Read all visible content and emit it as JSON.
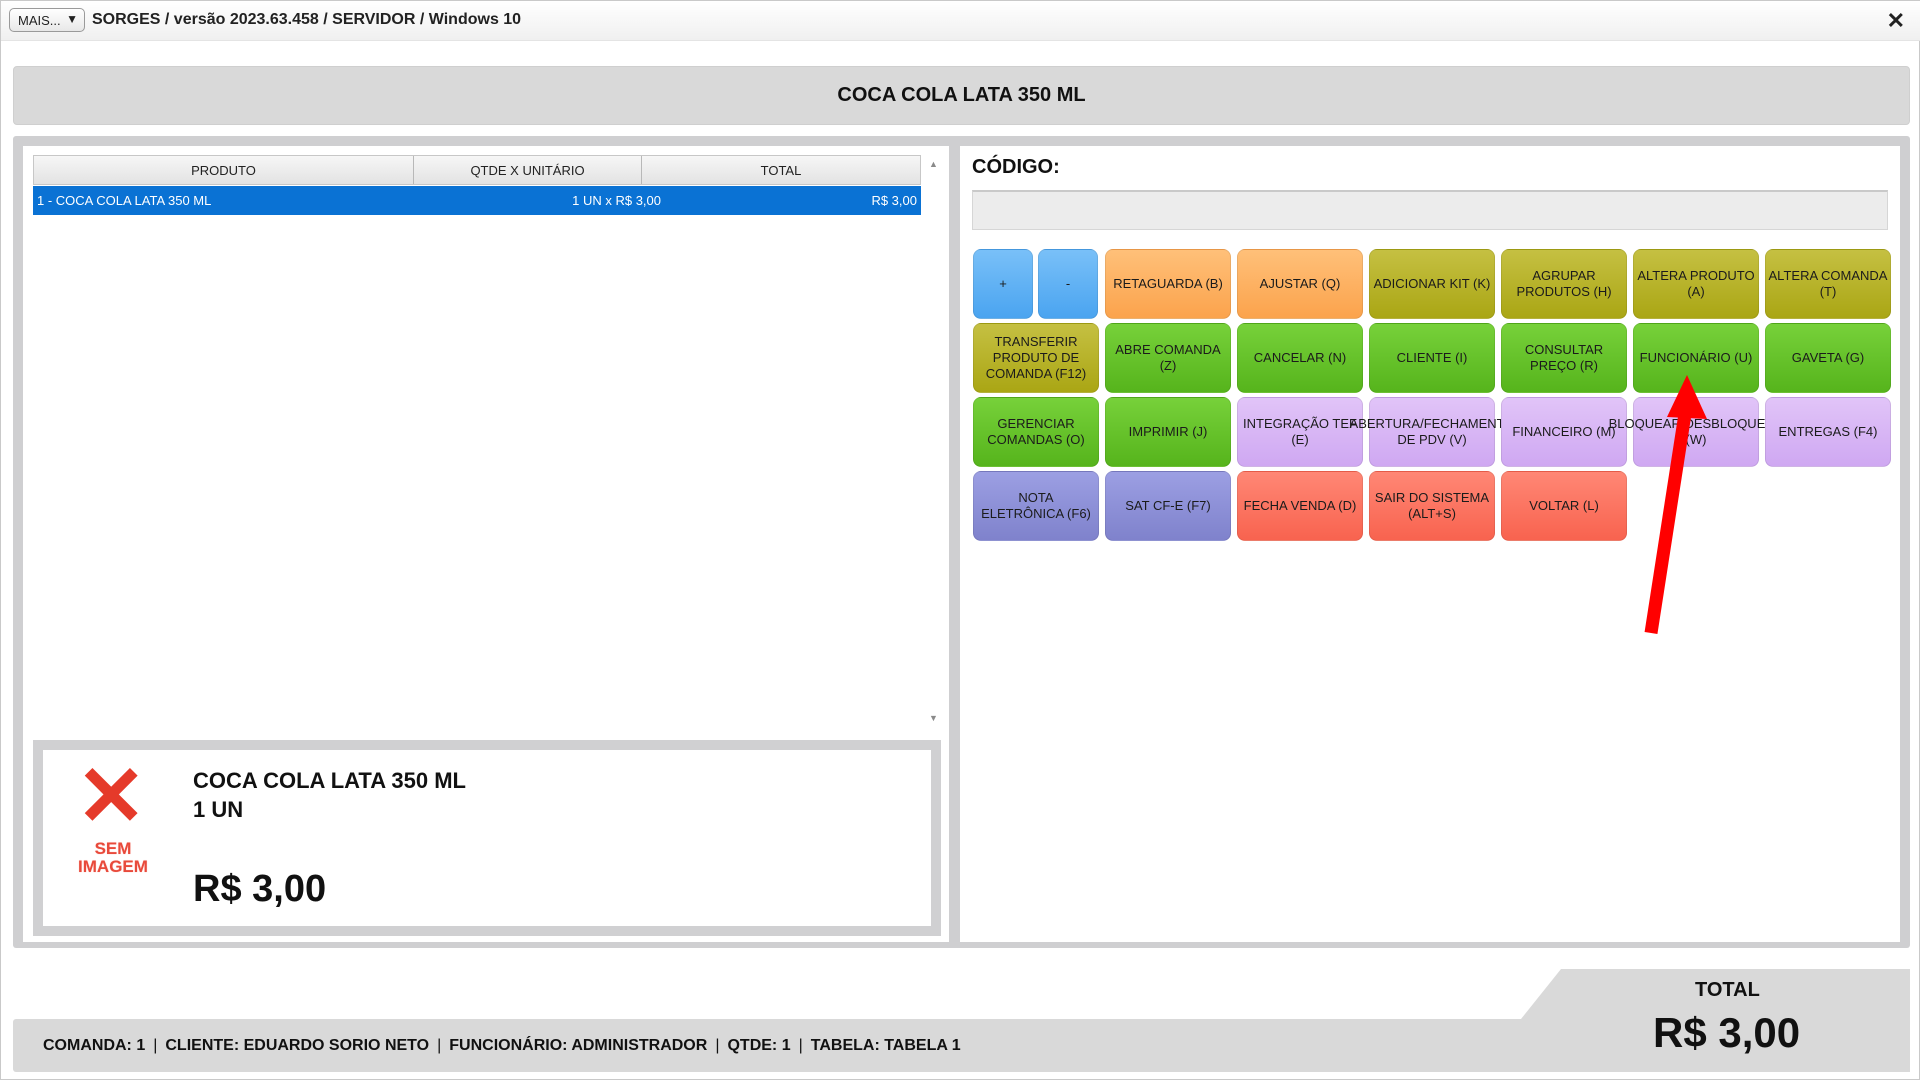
{
  "window": {
    "mais_label": "MAIS...",
    "mais_arrow": "▼",
    "title": "SORGES / versão 2023.63.458 / SERVIDOR / Windows 10",
    "close_glyph": "✕"
  },
  "product_header": "COCA COLA LATA 350 ML",
  "grid": {
    "columns": [
      "PRODUTO",
      "QTDE X UNITÁRIO",
      "TOTAL"
    ],
    "rows": [
      {
        "produto": "1 - COCA COLA LATA 350 ML",
        "qtde": "1 UN x R$ 3,00",
        "total": "R$ 3,00"
      }
    ],
    "scroll_up": "▲",
    "scroll_down": "▼"
  },
  "detail": {
    "no_image_glyph": "✕",
    "no_image_text": "SEM IMAGEM",
    "name": "COCA COLA LATA 350 ML",
    "qty": "1  UN",
    "price": "R$ 3,00"
  },
  "codigo": {
    "label": "CÓDIGO:",
    "value": ""
  },
  "buttons": [
    {
      "label": "+",
      "color": "blue"
    },
    {
      "label": "-",
      "color": "blue"
    },
    {
      "label": "RETAGUARDA (B)",
      "color": "orange"
    },
    {
      "label": "AJUSTAR (Q)",
      "color": "orange"
    },
    {
      "label": "ADICIONAR KIT (K)",
      "color": "olive"
    },
    {
      "label": "AGRUPAR PRODUTOS (H)",
      "color": "olive"
    },
    {
      "label": "ALTERA PRODUTO (A)",
      "color": "olive"
    },
    {
      "label": "ALTERA COMANDA (T)",
      "color": "olive"
    },
    {
      "label": "TRANSFERIR PRODUTO DE COMANDA (F12)",
      "color": "olive"
    },
    {
      "label": "ABRE COMANDA (Z)",
      "color": "green"
    },
    {
      "label": "CANCELAR (N)",
      "color": "green"
    },
    {
      "label": "CLIENTE (I)",
      "color": "green"
    },
    {
      "label": "CONSULTAR PREÇO (R)",
      "color": "green"
    },
    {
      "label": "FUNCIONÁRIO (U)",
      "color": "green"
    },
    {
      "label": "GAVETA (G)",
      "color": "green"
    },
    {
      "label": "GERENCIAR COMANDAS (O)",
      "color": "green"
    },
    {
      "label": "IMPRIMIR (J)",
      "color": "green"
    },
    {
      "label": "INTEGRAÇÃO TEF (E)",
      "color": "lilac"
    },
    {
      "label": "ABERTURA/FECHAMENTO DE PDV (V)",
      "color": "lilac"
    },
    {
      "label": "FINANCEIRO (M)",
      "color": "lilac"
    },
    {
      "label": "BLOQUEAR/DESBLOQUEAR (W)",
      "color": "lilac"
    },
    {
      "label": "ENTREGAS (F4)",
      "color": "lilac"
    },
    {
      "label": "NOTA ELETRÔNICA (F6)",
      "color": "indigo"
    },
    {
      "label": "SAT CF-E (F7)",
      "color": "indigo"
    },
    {
      "label": "FECHA VENDA (D)",
      "color": "salmon"
    },
    {
      "label": "SAIR DO SISTEMA (ALT+S)",
      "color": "salmon"
    },
    {
      "label": "VOLTAR (L)",
      "color": "salmon"
    }
  ],
  "status": {
    "comanda": "COMANDA: 1",
    "cliente": "CLIENTE: EDUARDO SORIO NETO",
    "funcionario": "FUNCIONÁRIO: ADMINISTRADOR",
    "qtde": "QTDE: 1",
    "tabela": "TABELA: TABELA 1",
    "separator": "|"
  },
  "total": {
    "label": "TOTAL",
    "value": "R$ 3,00"
  },
  "colors": {
    "selected_row": "#0a72d4",
    "arrow": "#ff0000"
  }
}
